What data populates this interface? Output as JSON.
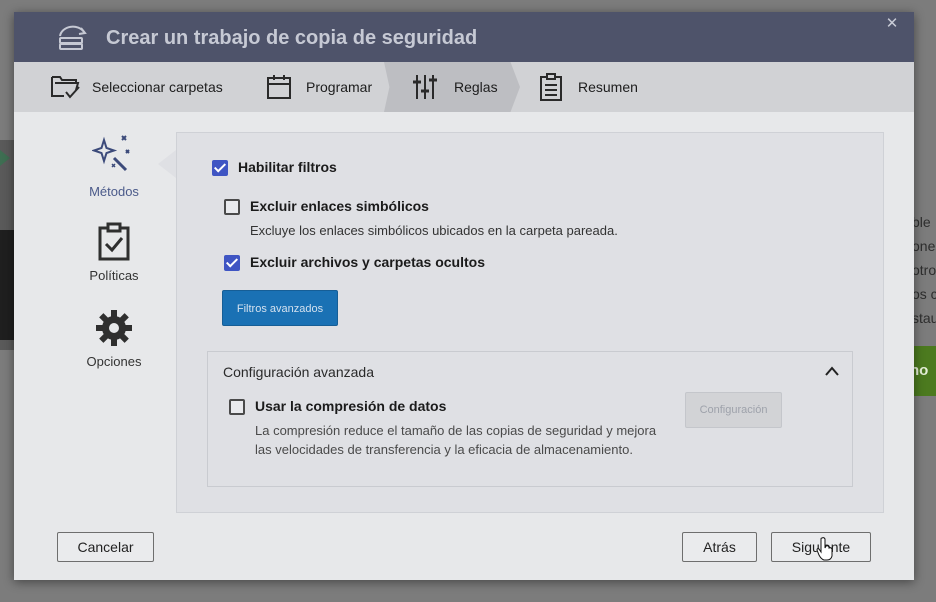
{
  "dialog": {
    "title": "Crear un trabajo de copia de seguridad",
    "close_glyph": "✕"
  },
  "steps": [
    {
      "label": "Seleccionar carpetas",
      "icon": "folder-check-icon"
    },
    {
      "label": "Programar",
      "icon": "calendar-icon"
    },
    {
      "label": "Reglas",
      "icon": "sliders-icon",
      "active": true
    },
    {
      "label": "Resumen",
      "icon": "clipboard-list-icon"
    }
  ],
  "sidebar": {
    "items": [
      {
        "label": "Métodos",
        "icon": "magic-wand-icon",
        "active": true
      },
      {
        "label": "Políticas",
        "icon": "clipboard-check-icon"
      },
      {
        "label": "Opciones",
        "icon": "gear-icon"
      }
    ]
  },
  "filters": {
    "enable_label": "Habilitar filtros",
    "enable_checked": true,
    "exclude_symlinks_label": "Excluir enlaces simbólicos",
    "exclude_symlinks_checked": false,
    "exclude_symlinks_desc": "Excluye los enlaces simbólicos ubicados en la carpeta pareada.",
    "exclude_hidden_label": "Excluir archivos y carpetas ocultos",
    "exclude_hidden_checked": true,
    "advanced_filters_button": "Filtros avanzados"
  },
  "advanced": {
    "title": "Configuración avanzada",
    "compression_label": "Usar la compresión de datos",
    "compression_checked": false,
    "compression_desc_line1": "La compresión reduce el tamaño de las copias de seguridad y mejora",
    "compression_desc_line2": "las velocidades de transferencia y la eficacia de almacenamiento.",
    "config_button": "Configuración"
  },
  "footer": {
    "cancel": "Cancelar",
    "back": "Atrás",
    "next": "Siguiente"
  },
  "background": {
    "right_text_lines": [
      "ble",
      "ones",
      "otro",
      "os c",
      "stau"
    ],
    "right_button_text": "ho"
  },
  "colors": {
    "titlebar": "#4e536a",
    "accent": "#3f55c3",
    "primary_button": "#1a71b4"
  }
}
